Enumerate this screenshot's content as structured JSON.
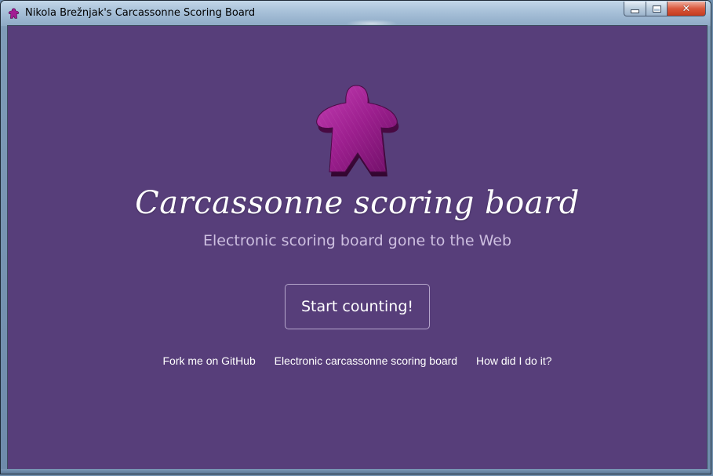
{
  "window": {
    "title": "Nikola Brežnjak's Carcassonne Scoring Board",
    "controls": {
      "minimize": "minimize",
      "maximize": "maximize",
      "close": "✕"
    }
  },
  "hero": {
    "logo_icon": "meeple-icon",
    "title": "Carcassonne scoring board",
    "subtitle": "Electronic scoring board gone to the Web"
  },
  "actions": {
    "start_label": "Start counting!"
  },
  "links": [
    {
      "label": "Fork me on GitHub"
    },
    {
      "label": "Electronic carcassonne scoring board"
    },
    {
      "label": "How did I do it?"
    }
  ],
  "colors": {
    "background": "#573e7a",
    "meeple": "#a02a93",
    "subtitle": "#cdbfe0"
  }
}
